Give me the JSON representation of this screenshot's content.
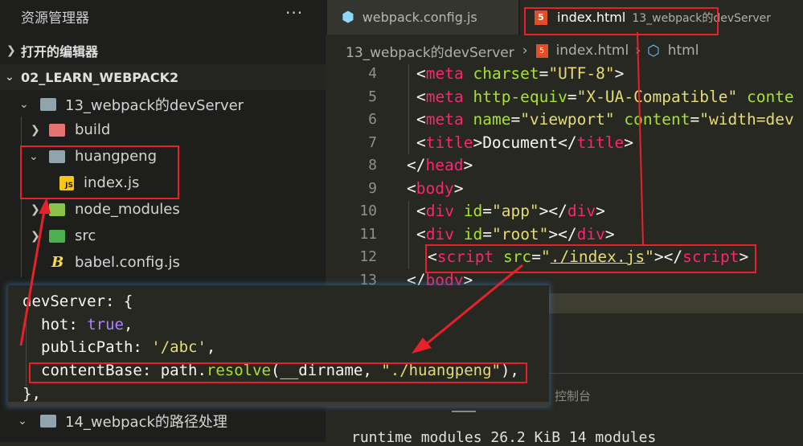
{
  "sidebar": {
    "title": "资源管理器",
    "more": "···",
    "open_editors": "打开的编辑器",
    "workspace": "02_LEARN_WEBPACK2",
    "items": [
      {
        "label": "13_webpack的devServer",
        "icon": "folder-open-icon"
      },
      {
        "label": "build",
        "icon": "folder-build-icon"
      },
      {
        "label": "huangpeng",
        "icon": "folder-open-icon"
      },
      {
        "label": "index.js",
        "icon": "js-file-icon"
      },
      {
        "label": "node_modules",
        "icon": "folder-node-icon"
      },
      {
        "label": "src",
        "icon": "folder-src-icon"
      },
      {
        "label": "babel.config.js",
        "icon": "babel-icon"
      },
      {
        "label": "14_webpack的路径处理",
        "icon": "folder-open-icon"
      }
    ]
  },
  "tabs": [
    {
      "label": "webpack.config.js",
      "icon": "webpack-icon"
    },
    {
      "label": "index.html",
      "description": "13_webpack的devServer",
      "icon": "html5-icon",
      "active": true
    }
  ],
  "breadcrumb": [
    "13_webpack的devServer",
    "index.html",
    "html"
  ],
  "editor": {
    "line_numbers": [
      "4",
      "5",
      "6",
      "7",
      "8",
      "9",
      "10",
      "11",
      "12",
      "13"
    ]
  },
  "popup_code": {
    "l1": "devServer: {",
    "hot_key": "hot: ",
    "hot_val": "true",
    "pp_key": "publicPath: ",
    "pp_val": "'/abc'",
    "cb_key": "contentBase: path.",
    "cb_fn": "resolve",
    "cb_args": "(__dirname, ",
    "cb_str": "\"./huangpeng\"",
    "cb_end": "),",
    "l5": "},"
  },
  "panel": {
    "tab_label": "控制台",
    "terminal_line": "runtime modules 26.2 KiB 14 modules"
  },
  "colors": {
    "tag": "#f92672",
    "attr": "#a6e22e",
    "string": "#e6db74",
    "annotation": "#e8202a"
  }
}
